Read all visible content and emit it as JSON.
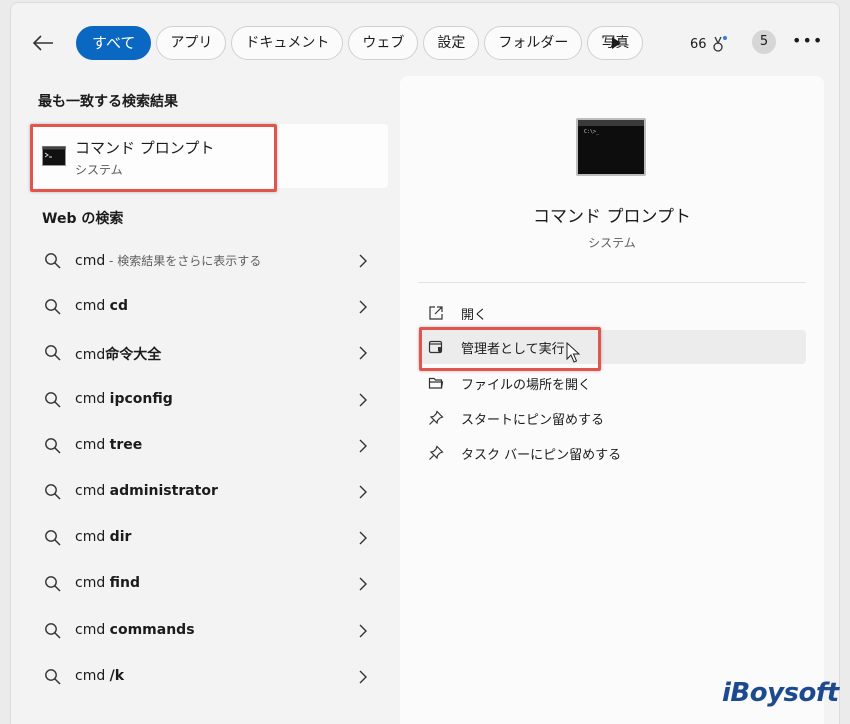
{
  "filters": {
    "back_icon": "arrow-left-icon",
    "tabs": [
      {
        "label": "すべて",
        "active": true
      },
      {
        "label": "アプリ"
      },
      {
        "label": "ドキュメント"
      },
      {
        "label": "ウェブ"
      },
      {
        "label": "設定"
      },
      {
        "label": "フォルダー"
      },
      {
        "label": "写真"
      }
    ],
    "play_icon": "play-icon",
    "points": "66",
    "points_icon": "rewards-medal-icon",
    "badge": "5",
    "more_icon": "more-dots-icon"
  },
  "best_match": {
    "title": "最も一致する検索結果",
    "name": "コマンド プロンプト",
    "sub": "システム",
    "icon": "command-prompt-icon"
  },
  "web": {
    "title": "Web の検索",
    "items": [
      {
        "q": "cmd",
        "bold": "",
        "hint": " - 検索結果をさらに表示する"
      },
      {
        "q": "cmd ",
        "bold": "cd",
        "hint": ""
      },
      {
        "q": "cmd",
        "bold": "命令大全",
        "hint": ""
      },
      {
        "q": "cmd ",
        "bold": "ipconfig",
        "hint": ""
      },
      {
        "q": "cmd ",
        "bold": "tree",
        "hint": ""
      },
      {
        "q": "cmd ",
        "bold": "administrator",
        "hint": ""
      },
      {
        "q": "cmd ",
        "bold": "dir",
        "hint": ""
      },
      {
        "q": "cmd ",
        "bold": "find",
        "hint": ""
      },
      {
        "q": "cmd ",
        "bold": "commands",
        "hint": ""
      },
      {
        "q": "cmd ",
        "bold": "/k",
        "hint": ""
      }
    ]
  },
  "preview": {
    "name": "コマンド プロンプト",
    "sub": "システム",
    "icon_prompt": "C:\\>_",
    "actions": [
      {
        "label": "開く",
        "icon": "open-external-icon"
      },
      {
        "label": "管理者として実行",
        "icon": "shield-window-icon"
      },
      {
        "label": "ファイルの場所を開く",
        "icon": "folder-open-icon"
      },
      {
        "label": "スタートにピン留めする",
        "icon": "pin-icon"
      },
      {
        "label": "タスク バーにピン留めする",
        "icon": "pin-icon"
      }
    ]
  },
  "watermark": "iBoysoft",
  "colors": {
    "accent": "#0a67c2",
    "highlight": "#e2554d"
  }
}
